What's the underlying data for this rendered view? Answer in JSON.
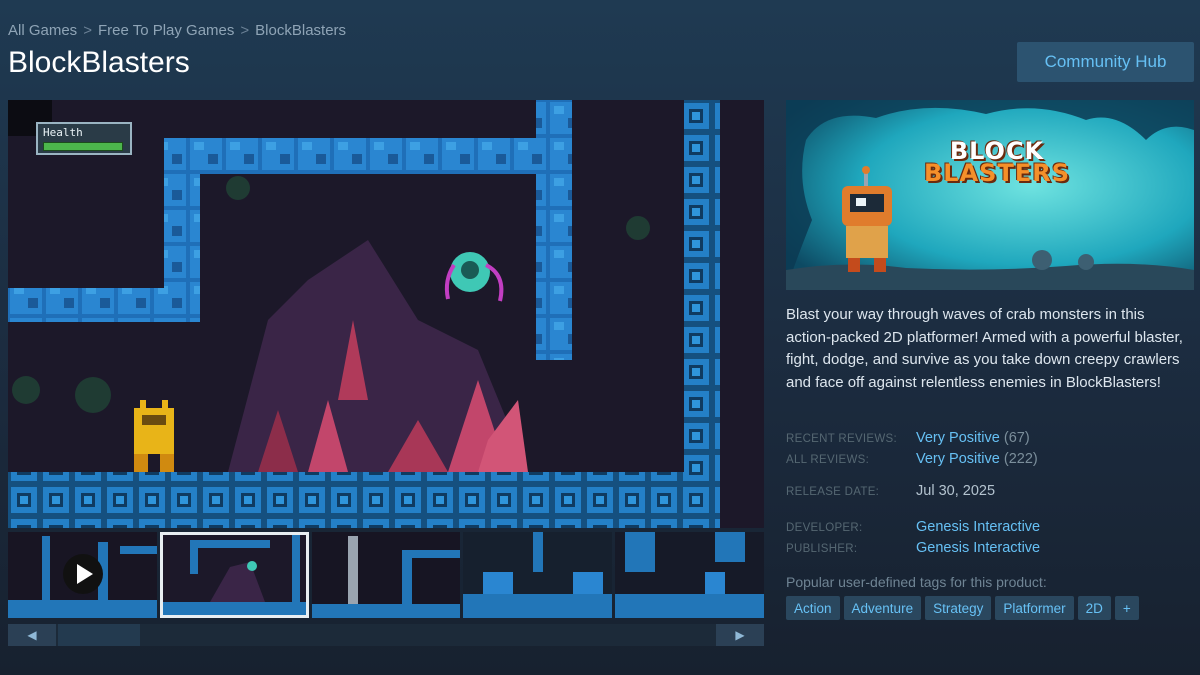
{
  "breadcrumb": {
    "items": [
      "All Games",
      "Free To Play Games",
      "BlockBlasters"
    ],
    "separator": ">"
  },
  "title": "BlockBlasters",
  "community_hub_label": "Community Hub",
  "media": {
    "health_label": "Health",
    "thumbnails_count": 5,
    "selected_thumbnail": 2
  },
  "capsule": {
    "title_line1": "BLOCK",
    "title_line2": "BLASTERS"
  },
  "description": "Blast your way through waves of crab monsters in this action-packed 2D platformer! Armed with a powerful blaster, fight, dodge, and survive as you take down creepy crawlers and face off against relentless enemies in BlockBlasters!",
  "reviews": {
    "recent_label": "RECENT REVIEWS:",
    "recent_value": "Very Positive",
    "recent_count": "(67)",
    "all_label": "ALL REVIEWS:",
    "all_value": "Very Positive",
    "all_count": "(222)"
  },
  "release": {
    "label": "RELEASE DATE:",
    "value": "Jul 30, 2025"
  },
  "developer": {
    "label": "DEVELOPER:",
    "value": "Genesis Interactive"
  },
  "publisher": {
    "label": "PUBLISHER:",
    "value": "Genesis Interactive"
  },
  "tags": {
    "label": "Popular user-defined tags for this product:",
    "items": [
      "Action",
      "Adventure",
      "Strategy",
      "Platformer",
      "2D",
      "+"
    ]
  },
  "scroll": {
    "left_arrow": "◀",
    "right_arrow": "▶"
  },
  "colors": {
    "link": "#66c0f4",
    "tag_bg": "#2a475e",
    "page_bg": "#1b2838"
  }
}
